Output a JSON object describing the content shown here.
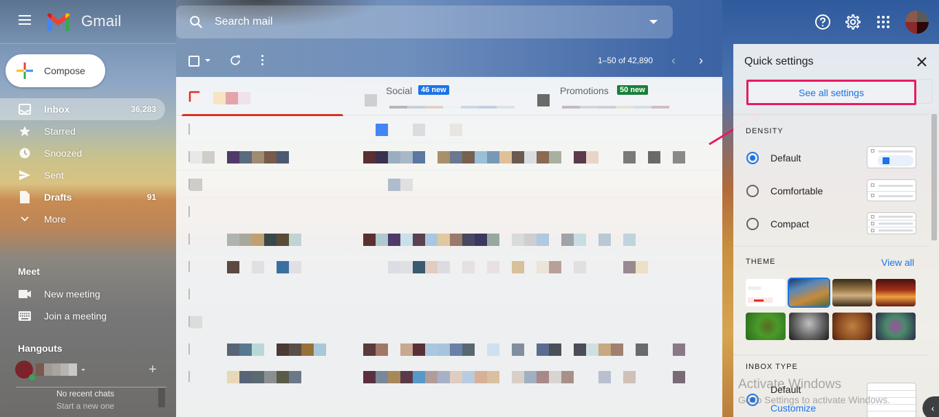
{
  "app": {
    "name": "Gmail"
  },
  "header": {
    "menu_icon": "hamburger-menu-icon",
    "search": {
      "placeholder": "Search mail",
      "value": ""
    },
    "icons": [
      "help-icon",
      "settings-gear-icon",
      "apps-grid-icon",
      "account-avatar"
    ]
  },
  "compose": {
    "label": "Compose"
  },
  "sidebar": {
    "items": [
      {
        "label": "Inbox",
        "count": "36,283",
        "icon": "inbox-icon",
        "active": true,
        "bold": true
      },
      {
        "label": "Starred",
        "count": "",
        "icon": "star-icon",
        "active": false,
        "bold": false
      },
      {
        "label": "Snoozed",
        "count": "",
        "icon": "clock-icon",
        "active": false,
        "bold": false
      },
      {
        "label": "Sent",
        "count": "",
        "icon": "send-icon",
        "active": false,
        "bold": false
      },
      {
        "label": "Drafts",
        "count": "91",
        "icon": "draft-file-icon",
        "active": false,
        "bold": true
      },
      {
        "label": "More",
        "count": "",
        "icon": "chevron-down-icon",
        "active": false,
        "bold": false
      }
    ],
    "meet": {
      "title": "Meet",
      "items": [
        {
          "label": "New meeting",
          "icon": "video-camera-icon"
        },
        {
          "label": "Join a meeting",
          "icon": "keyboard-icon"
        }
      ]
    },
    "hangouts": {
      "title": "Hangouts",
      "no_chats": "No recent chats",
      "start_new": "Start a new one"
    }
  },
  "toolbar": {
    "page_range": "1–50 of 42,890"
  },
  "tabs": [
    {
      "label": "Primary",
      "badge": "",
      "active": true
    },
    {
      "label": "Social",
      "badge": "46 new",
      "badge_color": "#1a73e8",
      "active": false
    },
    {
      "label": "Promotions",
      "badge": "50 new",
      "badge_color": "#188038",
      "active": false
    }
  ],
  "quick_settings": {
    "title": "Quick settings",
    "see_all": "See all settings",
    "density": {
      "title": "DENSITY",
      "options": [
        {
          "label": "Default",
          "selected": true
        },
        {
          "label": "Comfortable",
          "selected": false
        },
        {
          "label": "Compact",
          "selected": false
        }
      ]
    },
    "theme": {
      "title": "THEME",
      "view_all": "View all",
      "options": [
        "Default",
        "Golden Gate",
        "Chess",
        "Canyon",
        "Bud",
        "Bubbles",
        "Leaves",
        "Bokeh"
      ],
      "selected": "Golden Gate"
    },
    "inbox_type": {
      "title": "INBOX TYPE",
      "options": [
        {
          "label": "Default",
          "selected": true
        }
      ],
      "customize": "Customize"
    }
  },
  "overlay": {
    "watermark_title": "Activate Windows",
    "watermark_sub": "Go to Settings to activate Windows."
  },
  "colors": {
    "accent_blue": "#1a73e8",
    "inbox_red": "#d93025",
    "highlight_pink": "#e8185f",
    "promo_green": "#188038"
  }
}
